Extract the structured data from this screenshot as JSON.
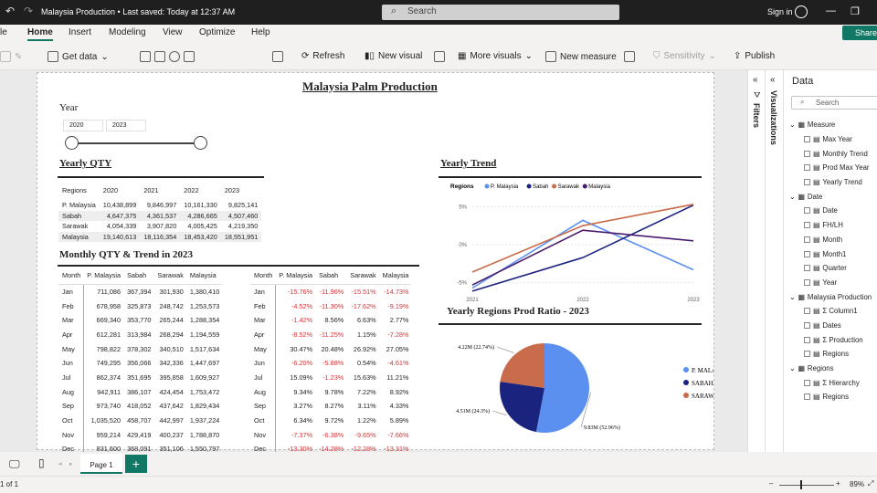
{
  "window": {
    "title": "Malaysia Production • Last saved: Today at 12:37 AM",
    "search_placeholder": "Search",
    "signin": "Sign in"
  },
  "ribbon": {
    "tabs": [
      "le",
      "Home",
      "Insert",
      "Modeling",
      "View",
      "Optimize",
      "Help"
    ],
    "active_tab": "Home",
    "share": "Share",
    "buttons": {
      "get_data": "Get data",
      "refresh": "Refresh",
      "new_visual": "New visual",
      "more_visuals": "More visuals",
      "new_measure": "New measure",
      "sensitivity": "Sensitivity",
      "publish": "Publish"
    }
  },
  "report": {
    "title": "Malaysia Palm Production",
    "slicer": {
      "label": "Year",
      "from": "2020",
      "to": "2023"
    },
    "yearly_qty": {
      "title": "Yearly QTY",
      "columns": [
        "Regions",
        "2020",
        "2021",
        "2022",
        "2023"
      ],
      "rows": [
        [
          "P. Malaysia",
          "10,438,899",
          "9,846,997",
          "10,161,330",
          "9,825,141"
        ],
        [
          "Sabah",
          "4,647,375",
          "4,361,537",
          "4,286,665",
          "4,507,460"
        ],
        [
          "Sarawak",
          "4,054,339",
          "3,907,820",
          "4,005,425",
          "4,219,350"
        ],
        [
          "Malaysia",
          "19,140,613",
          "18,116,354",
          "18,453,420",
          "18,551,951"
        ]
      ]
    },
    "monthly": {
      "title": "Monthly QTY & Trend in 2023",
      "qty_columns": [
        "Month",
        "P. Malaysia",
        "Sabah",
        "Sarawak",
        "Malaysia"
      ],
      "qty_rows": [
        [
          "Jan",
          "711,086",
          "367,394",
          "301,930",
          "1,380,410"
        ],
        [
          "Feb",
          "678,958",
          "325,873",
          "248,742",
          "1,253,573"
        ],
        [
          "Mar",
          "669,340",
          "353,770",
          "265,244",
          "1,288,354"
        ],
        [
          "Apr",
          "612,281",
          "313,984",
          "268,294",
          "1,194,559"
        ],
        [
          "May",
          "798,822",
          "378,302",
          "340,510",
          "1,517,634"
        ],
        [
          "Jun",
          "749,295",
          "356,066",
          "342,336",
          "1,447,697"
        ],
        [
          "Jul",
          "862,374",
          "351,695",
          "395,858",
          "1,609,927"
        ],
        [
          "Aug",
          "942,911",
          "386,107",
          "424,454",
          "1,753,472"
        ],
        [
          "Sep",
          "973,740",
          "418,052",
          "437,642",
          "1,829,434"
        ],
        [
          "Oct",
          "1,035,520",
          "458,707",
          "442,997",
          "1,937,224"
        ],
        [
          "Nov",
          "959,214",
          "429,419",
          "400,237",
          "1,788,870"
        ],
        [
          "Dec",
          "831,600",
          "368,091",
          "351,106",
          "1,550,797"
        ]
      ],
      "trend_columns": [
        "Month",
        "P. Malaysia",
        "Sabah",
        "Sarawak",
        "Malaysia"
      ],
      "trend_rows": [
        [
          "Jan",
          "-15.76%",
          "-11.96%",
          "-15.51%",
          "-14.73%"
        ],
        [
          "Feb",
          "-4.52%",
          "-11.30%",
          "-17.62%",
          "-9.19%"
        ],
        [
          "Mar",
          "-1.42%",
          "8.56%",
          "6.63%",
          "2.77%"
        ],
        [
          "Apr",
          "-8.52%",
          "-11.25%",
          "1.15%",
          "-7.28%"
        ],
        [
          "May",
          "30.47%",
          "20.48%",
          "26.92%",
          "27.05%"
        ],
        [
          "Jun",
          "-6.20%",
          "-5.88%",
          "0.54%",
          "-4.61%"
        ],
        [
          "Jul",
          "15.09%",
          "-1.23%",
          "15.63%",
          "11.21%"
        ],
        [
          "Aug",
          "9.34%",
          "9.78%",
          "7.22%",
          "8.92%"
        ],
        [
          "Sep",
          "3.27%",
          "8.27%",
          "3.11%",
          "4.33%"
        ],
        [
          "Oct",
          "6.34%",
          "9.72%",
          "1.22%",
          "5.89%"
        ],
        [
          "Nov",
          "-7.37%",
          "-6.38%",
          "-9.65%",
          "-7.66%"
        ],
        [
          "Dec",
          "-13.30%",
          "-14.28%",
          "-12.28%",
          "-13.31%"
        ]
      ]
    },
    "trend_title": "Yearly Trend",
    "pie_title": "Yearly Regions Prod Ratio - 2023"
  },
  "chart_data": [
    {
      "type": "line",
      "title": "Yearly Trend",
      "legend_title": "Regions",
      "legend_position": "top-left",
      "x": [
        "2021",
        "2022",
        "2023"
      ],
      "ylim": [
        -6,
        6
      ],
      "yticks": [
        "5%",
        "0%",
        "-5%"
      ],
      "ytick_values": [
        5,
        0,
        -5
      ],
      "series": [
        {
          "name": "P. Malaysia",
          "color": "#5b8ff0",
          "values": [
            -5.7,
            3.2,
            -3.3
          ]
        },
        {
          "name": "Sabah",
          "color": "#1a237e",
          "values": [
            -6.1,
            -1.7,
            5.2
          ]
        },
        {
          "name": "Sarawak",
          "color": "#c96c4b",
          "values": [
            -3.6,
            2.5,
            5.3
          ]
        },
        {
          "name": "Malaysia",
          "color": "#4a1a6e",
          "values": [
            -5.3,
            1.9,
            0.5
          ]
        }
      ]
    },
    {
      "type": "pie",
      "title": "Yearly Regions Prod Ratio - 2023",
      "legend_position": "right",
      "slices": [
        {
          "name": "P. MALAYSIA",
          "value": 9.83,
          "label": "9.83M (52.96%)",
          "color": "#5b8ff0"
        },
        {
          "name": "SABAH",
          "value": 4.51,
          "label": "4.51M (24.3%)",
          "color": "#1a237e"
        },
        {
          "name": "SARAWAK",
          "value": 4.22,
          "label": "4.22M (22.74%)",
          "color": "#c96c4b"
        }
      ]
    }
  ],
  "right_pane": {
    "filters": "Filters",
    "visualizations": "Visualizations",
    "data_title": "Data",
    "search_placeholder": "Search",
    "tree": [
      {
        "t": "g",
        "label": "Measure"
      },
      {
        "t": "f",
        "label": "Max Year"
      },
      {
        "t": "f",
        "label": "Monthly Trend"
      },
      {
        "t": "f",
        "label": "Prod Max Year"
      },
      {
        "t": "f",
        "label": "Yearly Trend"
      },
      {
        "t": "g",
        "label": "Date"
      },
      {
        "t": "f",
        "label": "Date"
      },
      {
        "t": "f",
        "label": "FH/LH"
      },
      {
        "t": "f",
        "label": "Month"
      },
      {
        "t": "f",
        "label": "Month1"
      },
      {
        "t": "f",
        "label": "Quarter"
      },
      {
        "t": "f",
        "label": "Year"
      },
      {
        "t": "g",
        "label": "Malaysia Production"
      },
      {
        "t": "f",
        "label": "Σ  Column1"
      },
      {
        "t": "f",
        "label": "Dates"
      },
      {
        "t": "f",
        "label": "Σ  Production"
      },
      {
        "t": "f",
        "label": "Regions"
      },
      {
        "t": "g",
        "label": "Regions"
      },
      {
        "t": "f",
        "label": "Σ  Hierarchy"
      },
      {
        "t": "f",
        "label": "Regions"
      }
    ]
  },
  "bottom": {
    "page_tab": "Page 1",
    "add": "+",
    "page_count": "1 of 1",
    "zoom": "89%"
  }
}
